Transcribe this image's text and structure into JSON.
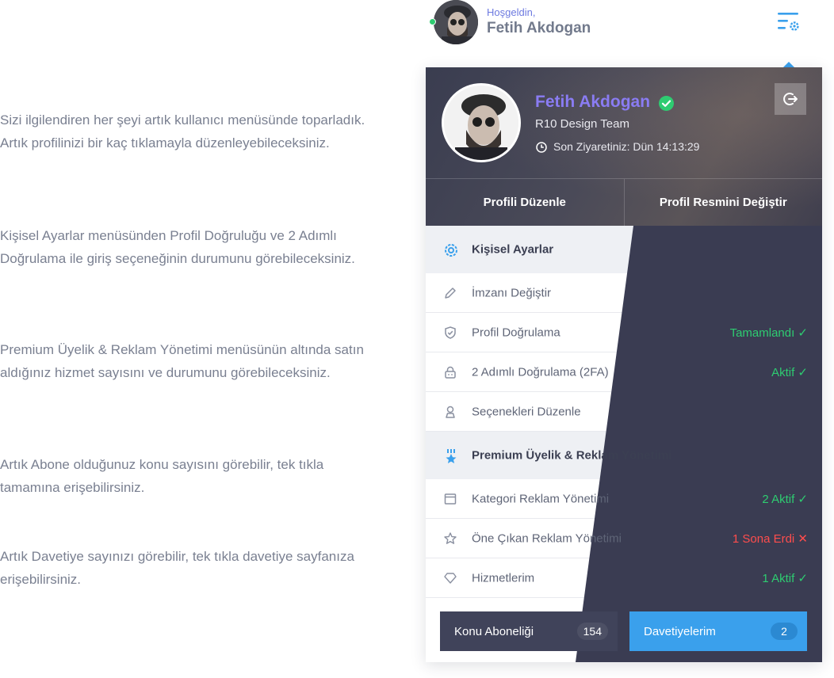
{
  "intro": [
    "Sizi ilgilendiren her şeyi artık kullanıcı menüsünde toparladık. Artık profilinizi bir kaç tıklamayla düzenleyebileceksiniz.",
    "Kişisel Ayarlar menüsünden Profil Doğruluğu ve 2 Adımlı Doğrulama ile giriş seçeneğinin durumunu görebileceksiniz.",
    "Premium Üyelik & Reklam Yönetimi menüsünün altında satın aldığınız hizmet sayısını ve durumunu görebileceksiniz.",
    "Artık Abone olduğunuz konu sayısını görebilir, tek tıkla tamamına erişebilirsiniz.",
    "Artık Davetiye sayınızı görebilir, tek tıkla davetiye sayfanıza erişebilirsiniz."
  ],
  "header": {
    "greeting": "Hoşgeldin,",
    "name": "Fetih Akdogan"
  },
  "profile": {
    "name": "Fetih Akdogan",
    "team": "R10 Design Team",
    "last_visit": "Son Ziyaretiniz: Dün 14:13:29",
    "edit_profile": "Profili Düzenle",
    "change_photo": "Profil Resmini Değiştir"
  },
  "personal": {
    "title": "Kişisel Ayarlar",
    "items": [
      {
        "label": "İmzanı Değiştir",
        "status": ""
      },
      {
        "label": "Profil Doğrulama",
        "status": "Tamamlandı ✓"
      },
      {
        "label": "2 Adımlı Doğrulama (2FA)",
        "status": "Aktif ✓"
      },
      {
        "label": "Seçenekleri Düzenle",
        "status": ""
      }
    ]
  },
  "premium": {
    "title": "Premium Üyelik & Reklam Yönetimi",
    "items": [
      {
        "label": "Kategori Reklam Yönetimi",
        "status": "2 Aktif  ✓"
      },
      {
        "label": "Öne Çıkan Reklam Yönetimi",
        "status": "1 Sona Erdi  ✕"
      },
      {
        "label": "Hizmetlerim",
        "status": "1 Aktif  ✓"
      }
    ]
  },
  "buttons": {
    "subscriptions": "Konu Aboneliği",
    "subscriptions_count": "154",
    "invites": "Davetiyelerim",
    "invites_count": "2"
  },
  "colors": {
    "accent_blue": "#3aa0ec",
    "accent_purple": "#8a7cf3",
    "success": "#2ecc71",
    "danger": "#ff4d4d",
    "dark_panel": "#3a3c52"
  }
}
